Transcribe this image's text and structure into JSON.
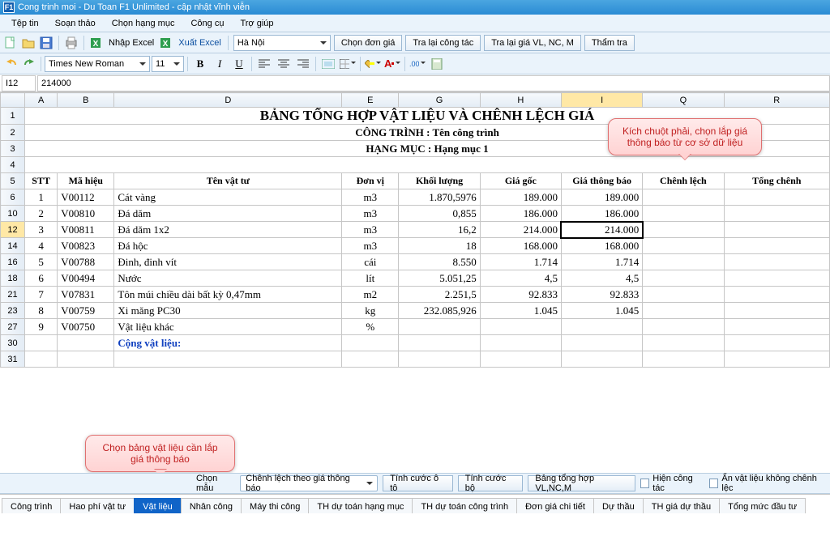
{
  "window": {
    "title": "Cong trinh moi - Du Toan F1 Unlimited - cập nhật vĩnh viễn",
    "app_badge": "F1"
  },
  "menu": {
    "items": [
      "Tệp tin",
      "Soạn thảo",
      "Chọn hạng mục",
      "Công cụ",
      "Trợ giúp"
    ]
  },
  "toolbar1": {
    "import": "Nhập Excel",
    "export": "Xuất Excel",
    "region": "Hà Nội",
    "buttons": [
      "Chọn đơn giá",
      "Tra lại công tác",
      "Tra lại giá VL, NC, M",
      "Thẩm tra"
    ]
  },
  "format": {
    "font": "Times New Roman",
    "size": "11"
  },
  "cell": {
    "ref": "I12",
    "value": "214000"
  },
  "columns": [
    "A",
    "B",
    "D",
    "E",
    "G",
    "H",
    "I",
    "Q",
    "R"
  ],
  "sheet": {
    "title": "BẢNG TỔNG HỢP VẬT LIỆU VÀ CHÊNH LỆCH GIÁ",
    "subtitle1": "CÔNG TRÌNH : Tên công trình",
    "subtitle2": "HẠNG MỤC : Hạng mục 1",
    "headers": [
      "STT",
      "Mã hiệu",
      "Tên vật tư",
      "Đơn vị",
      "Khối lượng",
      "Giá gốc",
      "Giá thông báo",
      "Chênh lệch",
      "Tổng chênh"
    ],
    "row_numbers": [
      "1",
      "2",
      "3",
      "4",
      "5",
      "6",
      "10",
      "12",
      "14",
      "16",
      "18",
      "21",
      "23",
      "27",
      "30",
      "31"
    ],
    "rows": [
      {
        "stt": "1",
        "ma": "V00112",
        "ten": "Cát vàng",
        "dv": "m3",
        "kl": "1.870,5976",
        "gg": "189.000",
        "gtb": "189.000"
      },
      {
        "stt": "2",
        "ma": "V00810",
        "ten": "Đá dăm",
        "dv": "m3",
        "kl": "0,855",
        "gg": "186.000",
        "gtb": "186.000"
      },
      {
        "stt": "3",
        "ma": "V00811",
        "ten": "Đá dăm 1x2",
        "dv": "m3",
        "kl": "16,2",
        "gg": "214.000",
        "gtb": "214.000"
      },
      {
        "stt": "4",
        "ma": "V00823",
        "ten": "Đá hộc",
        "dv": "m3",
        "kl": "18",
        "gg": "168.000",
        "gtb": "168.000"
      },
      {
        "stt": "5",
        "ma": "V00788",
        "ten": "Đinh, đinh vít",
        "dv": "cái",
        "kl": "8.550",
        "gg": "1.714",
        "gtb": "1.714"
      },
      {
        "stt": "6",
        "ma": "V00494",
        "ten": "Nước",
        "dv": "lít",
        "kl": "5.051,25",
        "gg": "4,5",
        "gtb": "4,5"
      },
      {
        "stt": "7",
        "ma": "V07831",
        "ten": "Tôn múi chiều dài bất kỳ 0,47mm",
        "dv": "m2",
        "kl": "2.251,5",
        "gg": "92.833",
        "gtb": "92.833"
      },
      {
        "stt": "8",
        "ma": "V00759",
        "ten": "Xi măng PC30",
        "dv": "kg",
        "kl": "232.085,926",
        "gg": "1.045",
        "gtb": "1.045"
      },
      {
        "stt": "9",
        "ma": "V00750",
        "ten": "Vật liệu khác",
        "dv": "%",
        "kl": "",
        "gg": "",
        "gtb": ""
      }
    ],
    "total_label": "Cộng vật liệu:"
  },
  "callouts": {
    "top": "Kích chuột phải, chọn lắp giá thông báo từ cơ sở dữ liệu",
    "bottom": "Chọn bảng vật liệu cần lắp giá thông báo"
  },
  "options": {
    "label": "Chọn mẫu",
    "template": "Chênh lệch theo giá thông báo",
    "buttons": [
      "Tính cước ô tô",
      "Tính cước bộ",
      "Bảng tổng hợp VL,NC,M"
    ],
    "chk1": "Hiện công tác",
    "chk2": "Ẩn vật liệu không chênh lệc"
  },
  "tabs": [
    "Công trình",
    "Hao phí vật tư",
    "Vật liệu",
    "Nhân công",
    "Máy thi công",
    "TH dự toán hạng mục",
    "TH dự toán công trình",
    "Đơn giá chi tiết",
    "Dự thầu",
    "TH giá dự thầu",
    "Tổng mức đầu tư"
  ],
  "active_tab": 2
}
